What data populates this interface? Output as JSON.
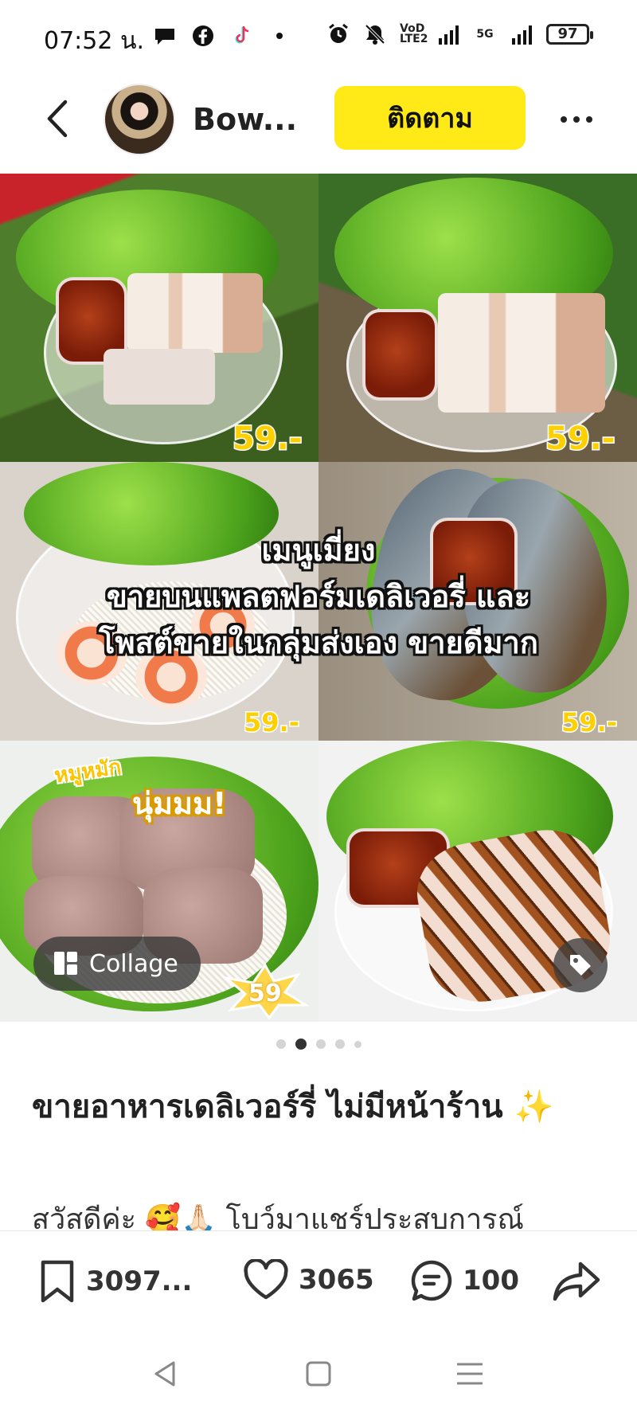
{
  "status_bar": {
    "time": "07:52 น.",
    "left_icons": [
      "chat-bubble-icon",
      "facebook-icon",
      "tiktok-icon",
      "dot-icon"
    ],
    "right_icons": [
      "alarm-icon",
      "mute-icon",
      "volte-icon",
      "signal-icon",
      "5g-icon",
      "battery-icon"
    ],
    "volte_label": "VoD LTE2",
    "fiveg_label": "5G",
    "battery": "97"
  },
  "header": {
    "author_name": "Bow...",
    "follow_label": "ติดตาม"
  },
  "media": {
    "prices": [
      "59.-",
      "59.-",
      "59.-",
      "59.-"
    ],
    "overlay_line1": "เมนูเมี่ยง",
    "overlay_line2": "ขายบนแพลตฟอร์มเดลิเวอรี่ และ",
    "overlay_line3": "โพสต์ขายในกลุ่มส่งเอง ขายดีมาก",
    "sticker_small": "หมูหมัก",
    "sticker_big": "นุ่มมม!",
    "star_price": "59",
    "collage_label": "Collage"
  },
  "pagination": {
    "count": 5,
    "active_index": 1
  },
  "post": {
    "title": "ขายอาหารเดลิเวอร์รี่ ไม่มีหน้าร้าน ✨",
    "body": "สวัสดีค่ะ 🥰🙏🏻 โบว์มาแชร์ประสบการณ์"
  },
  "actions": {
    "saves": "3097...",
    "likes": "3065",
    "comments": "100"
  },
  "colors": {
    "accent_yellow": "#ffe916",
    "price_yellow": "#ffd000"
  }
}
